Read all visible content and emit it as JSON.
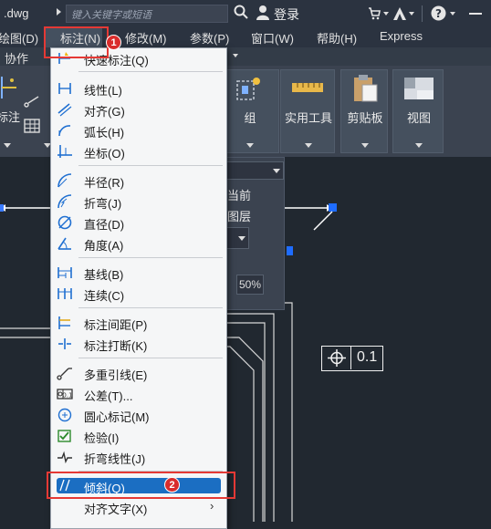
{
  "titlebar": {
    "filename": ".dwg",
    "search_placeholder": "键入关键字或短语",
    "login_label": "登录"
  },
  "menubar": {
    "items": [
      {
        "label": "绘图(D)"
      },
      {
        "label": "标注(N)"
      },
      {
        "label": "修改(M)"
      },
      {
        "label": "参数(P)"
      },
      {
        "label": "窗口(W)"
      },
      {
        "label": "帮助(H)"
      },
      {
        "label": "Express"
      }
    ]
  },
  "ribbon": {
    "tab_label": "协作",
    "side_label": "标注",
    "groups": [
      {
        "label": "组"
      },
      {
        "label": "实用工具"
      },
      {
        "label": "剪贴板"
      },
      {
        "label": "视图"
      }
    ]
  },
  "props_panel": {
    "current": "当前",
    "layer": "图层",
    "percent": "50%"
  },
  "dropdown": {
    "items": [
      {
        "label": "快速标注(Q)",
        "icon": "quick-dimension-icon"
      },
      {
        "label": "线性(L)",
        "icon": "linear-icon"
      },
      {
        "label": "对齐(G)",
        "icon": "aligned-icon"
      },
      {
        "label": "弧长(H)",
        "icon": "arc-length-icon"
      },
      {
        "label": "坐标(O)",
        "icon": "ordinate-icon"
      },
      {
        "label": "半径(R)",
        "icon": "radius-icon"
      },
      {
        "label": "折弯(J)",
        "icon": "jogged-icon"
      },
      {
        "label": "直径(D)",
        "icon": "diameter-icon"
      },
      {
        "label": "角度(A)",
        "icon": "angular-icon"
      },
      {
        "label": "基线(B)",
        "icon": "baseline-icon"
      },
      {
        "label": "连续(C)",
        "icon": "continue-icon"
      },
      {
        "label": "标注间距(P)",
        "icon": "dim-space-icon"
      },
      {
        "label": "标注打断(K)",
        "icon": "dim-break-icon"
      },
      {
        "label": "多重引线(E)",
        "icon": "multileader-icon"
      },
      {
        "label": "公差(T)...",
        "icon": "tolerance-icon"
      },
      {
        "label": "圆心标记(M)",
        "icon": "center-mark-icon"
      },
      {
        "label": "检验(I)",
        "icon": "inspect-icon"
      },
      {
        "label": "折弯线性(J)",
        "icon": "jogged-linear-icon"
      },
      {
        "label": "倾斜(Q)",
        "icon": "oblique-icon"
      },
      {
        "label": "对齐文字(X)",
        "icon": ""
      }
    ]
  },
  "callouts": {
    "badge1": "1",
    "badge2": "2"
  },
  "tolerance_frame": {
    "value": "0.1"
  },
  "colors": {
    "highlight": "#1b6ec2",
    "callout_red": "#e53935",
    "drawing_bg": "#212830"
  }
}
